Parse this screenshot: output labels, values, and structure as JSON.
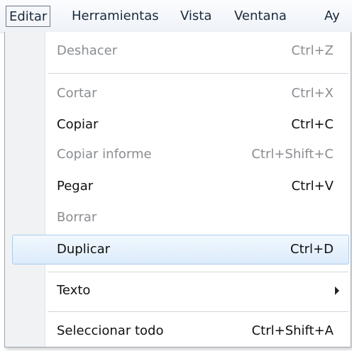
{
  "menubar": {
    "items": [
      {
        "label": "Editar"
      },
      {
        "label": "Herramientas"
      },
      {
        "label": "Vista"
      },
      {
        "label": "Ventana"
      },
      {
        "label": "Ay"
      }
    ],
    "active_item": "Editar"
  },
  "menu": {
    "items": [
      {
        "label": "Deshacer",
        "shortcut": "Ctrl+Z",
        "enabled": false
      },
      {
        "label": "Cortar",
        "shortcut": "Ctrl+X",
        "enabled": false
      },
      {
        "label": "Copiar",
        "shortcut": "Ctrl+C",
        "enabled": true
      },
      {
        "label": "Copiar informe",
        "shortcut": "Ctrl+Shift+C",
        "enabled": false
      },
      {
        "label": "Pegar",
        "shortcut": "Ctrl+V",
        "enabled": true
      },
      {
        "label": "Borrar",
        "shortcut": "",
        "enabled": false
      },
      {
        "label": "Duplicar",
        "shortcut": "Ctrl+D",
        "enabled": true,
        "highlighted": true
      },
      {
        "label": "Texto",
        "shortcut": "",
        "enabled": true,
        "submenu": true
      },
      {
        "label": "Seleccionar todo",
        "shortcut": "Ctrl+Shift+A",
        "enabled": true
      }
    ]
  },
  "colors": {
    "enabled_text": "#111111",
    "disabled_text": "#8a8d91",
    "highlight_border": "#a9cbee",
    "highlight_fill": "#dcebfb"
  },
  "icons": {
    "submenu": "chevron-right-icon"
  }
}
